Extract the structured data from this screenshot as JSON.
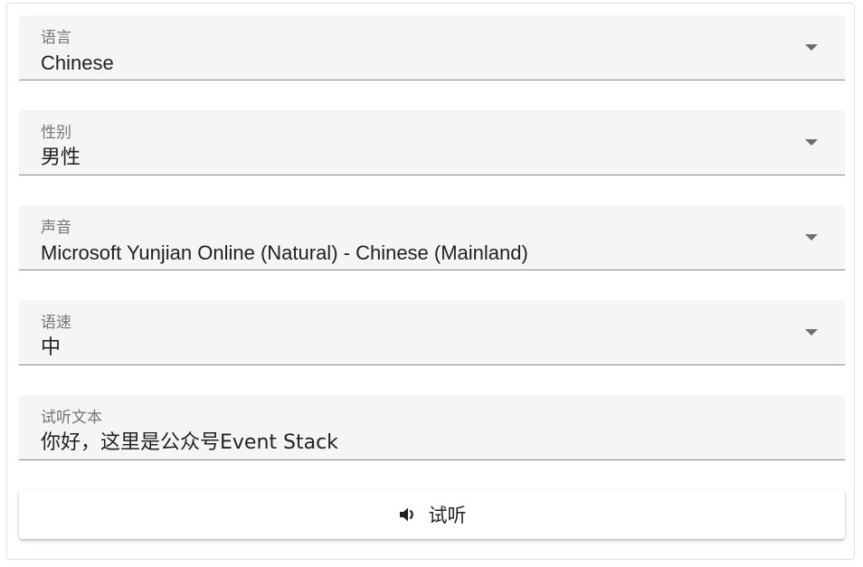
{
  "form": {
    "language": {
      "label": "语言",
      "value": "Chinese"
    },
    "gender": {
      "label": "性别",
      "value": "男性"
    },
    "voice": {
      "label": "声音",
      "value": "Microsoft Yunjian Online (Natural) - Chinese (Mainland)"
    },
    "rate": {
      "label": "语速",
      "value": "中"
    },
    "preview_text": {
      "label": "试听文本",
      "value": "你好，这里是公众号Event Stack"
    }
  },
  "preview_button": {
    "label": "试听",
    "icon": "volume-up-icon"
  },
  "colors": {
    "field_background": "#f5f5f5",
    "field_underline": "#8a8a8a",
    "label_text": "#757575",
    "value_text": "#212121"
  }
}
